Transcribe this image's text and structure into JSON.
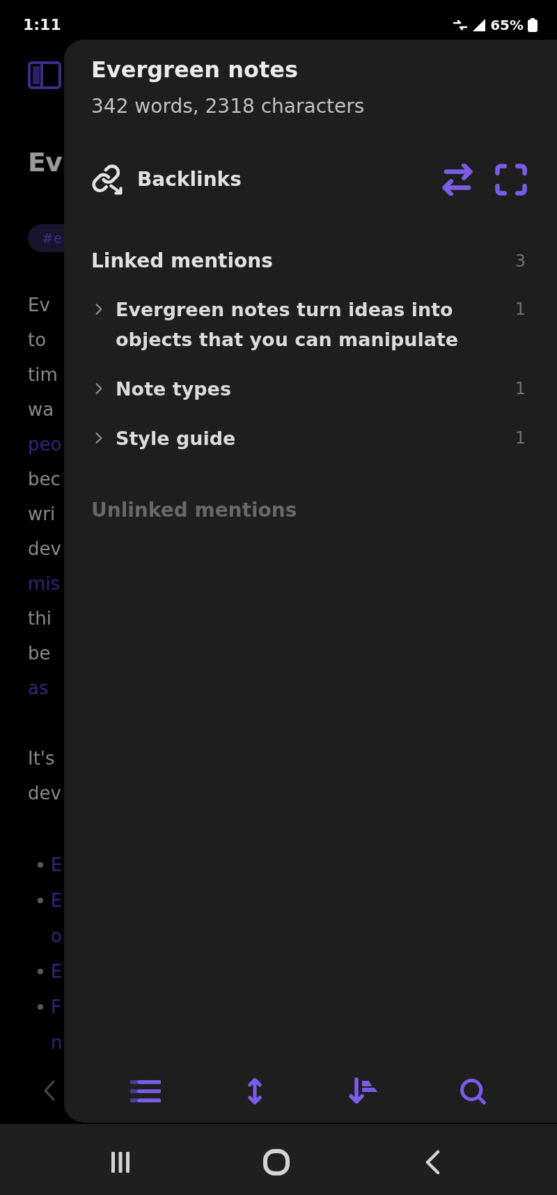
{
  "status_bar": {
    "time": "1:11",
    "battery": "65%"
  },
  "background_note": {
    "title": "Ev",
    "tag": "#e",
    "paragraphs": [
      [
        {
          "text": "Ev",
          "link": false
        },
        {
          "text": "to",
          "link": false
        },
        {
          "text": "tim",
          "link": false
        },
        {
          "text": "wa",
          "link": false
        },
        {
          "text": "peo",
          "link": true
        },
        {
          "text": "bec",
          "link": false
        },
        {
          "text": "wri",
          "link": false
        },
        {
          "text": "dev",
          "link": false
        },
        {
          "text": "mis",
          "link": true
        },
        {
          "text": "thi",
          "link": false
        },
        {
          "text": "be",
          "link": false
        },
        {
          "text": "as",
          "link": true
        }
      ],
      [
        {
          "text": "It's",
          "link": false
        },
        {
          "text": "dev",
          "link": false
        }
      ]
    ],
    "list": [
      {
        "lines": [
          "E"
        ]
      },
      {
        "lines": [
          "E",
          "o"
        ]
      },
      {
        "lines": [
          "E"
        ]
      },
      {
        "lines": [
          "F",
          "n"
        ]
      }
    ]
  },
  "panel": {
    "title": "Evergreen notes",
    "subtitle": "342 words, 2318 characters",
    "header": {
      "label": "Backlinks"
    },
    "sections": [
      {
        "title": "Linked mentions",
        "count": "3",
        "expanded": true,
        "items": [
          {
            "title": "Evergreen notes turn ideas into objects that you can manipulate",
            "count": "1",
            "expanded": false
          },
          {
            "title": "Note types",
            "count": "1",
            "expanded": false
          },
          {
            "title": "Style guide",
            "count": "1",
            "expanded": false
          }
        ]
      },
      {
        "title": "Unlinked mentions",
        "expanded": false
      }
    ]
  }
}
